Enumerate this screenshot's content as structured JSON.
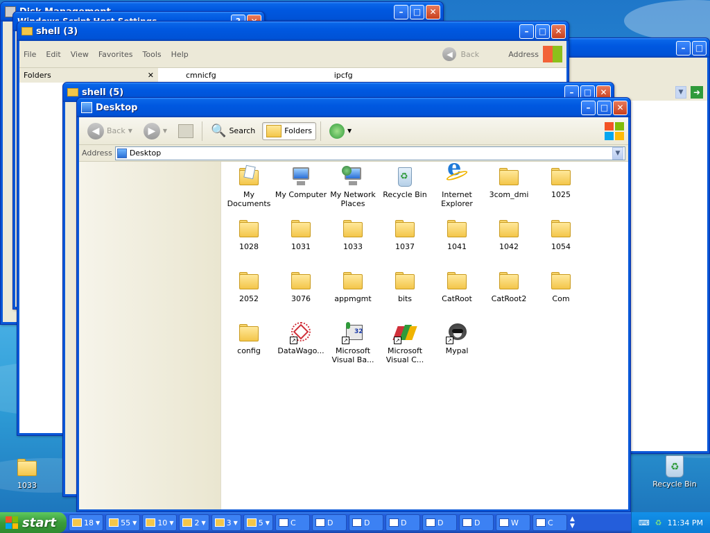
{
  "windows": {
    "disk_mgmt": {
      "title": "Disk Management"
    },
    "wsh": {
      "title": "Windows Script Host Settings"
    },
    "shell3": {
      "title": "shell (3)",
      "menu": [
        "File",
        "Edit",
        "View",
        "Favorites",
        "Tools",
        "Help"
      ],
      "back_label": "Back",
      "address_label": "Address",
      "folders_label": "Folders",
      "files": [
        "cmnicfg",
        "ipcfg"
      ]
    },
    "shell5": {
      "title": "shell (5)"
    },
    "desktop": {
      "title": "Desktop",
      "toolbar": {
        "back": "Back",
        "search": "Search",
        "folders": "Folders"
      },
      "address_label": "Address",
      "address_value": "Desktop",
      "items": [
        {
          "label": "My Documents",
          "icon": "my-documents"
        },
        {
          "label": "My Computer",
          "icon": "my-computer"
        },
        {
          "label": "My Network Places",
          "icon": "network"
        },
        {
          "label": "Recycle Bin",
          "icon": "recycle"
        },
        {
          "label": "Internet Explorer",
          "icon": "ie"
        },
        {
          "label": "3com_dmi",
          "icon": "folder"
        },
        {
          "label": "1025",
          "icon": "folder"
        },
        {
          "label": "1028",
          "icon": "folder"
        },
        {
          "label": "1031",
          "icon": "folder"
        },
        {
          "label": "1033",
          "icon": "folder"
        },
        {
          "label": "1037",
          "icon": "folder"
        },
        {
          "label": "1041",
          "icon": "folder"
        },
        {
          "label": "1042",
          "icon": "folder"
        },
        {
          "label": "1054",
          "icon": "folder"
        },
        {
          "label": "2052",
          "icon": "folder"
        },
        {
          "label": "3076",
          "icon": "folder"
        },
        {
          "label": "appmgmt",
          "icon": "folder"
        },
        {
          "label": "bits",
          "icon": "folder"
        },
        {
          "label": "CatRoot",
          "icon": "folder"
        },
        {
          "label": "CatRoot2",
          "icon": "folder"
        },
        {
          "label": "Com",
          "icon": "folder"
        },
        {
          "label": "config",
          "icon": "folder"
        },
        {
          "label": "DataWago...",
          "icon": "datawagon"
        },
        {
          "label": "Microsoft Visual Ba...",
          "icon": "vb"
        },
        {
          "label": "Microsoft Visual C...",
          "icon": "vc"
        },
        {
          "label": "Mypal",
          "icon": "mypal"
        }
      ]
    }
  },
  "desktop_icons": {
    "folder_1033": "1033",
    "recycle_bin": "Recycle Bin"
  },
  "taskbar": {
    "start_label": "start",
    "groups": [
      {
        "count": "18",
        "icon": "folder-icon"
      },
      {
        "count": "55",
        "icon": "document-icon"
      },
      {
        "count": "10",
        "icon": "tool-icon"
      },
      {
        "count": "2",
        "icon": "cmd-icon"
      },
      {
        "count": "3",
        "icon": "help-icon"
      },
      {
        "count": "5",
        "icon": "window-icon"
      }
    ],
    "singles": [
      "C",
      "D",
      "D",
      "D",
      "D",
      "D",
      "W",
      "C"
    ],
    "clock": "11:34 PM"
  },
  "colors": {
    "titlebar": "#0058e0",
    "close_button": "#c8401e",
    "start_button": "#3a9c3a"
  }
}
